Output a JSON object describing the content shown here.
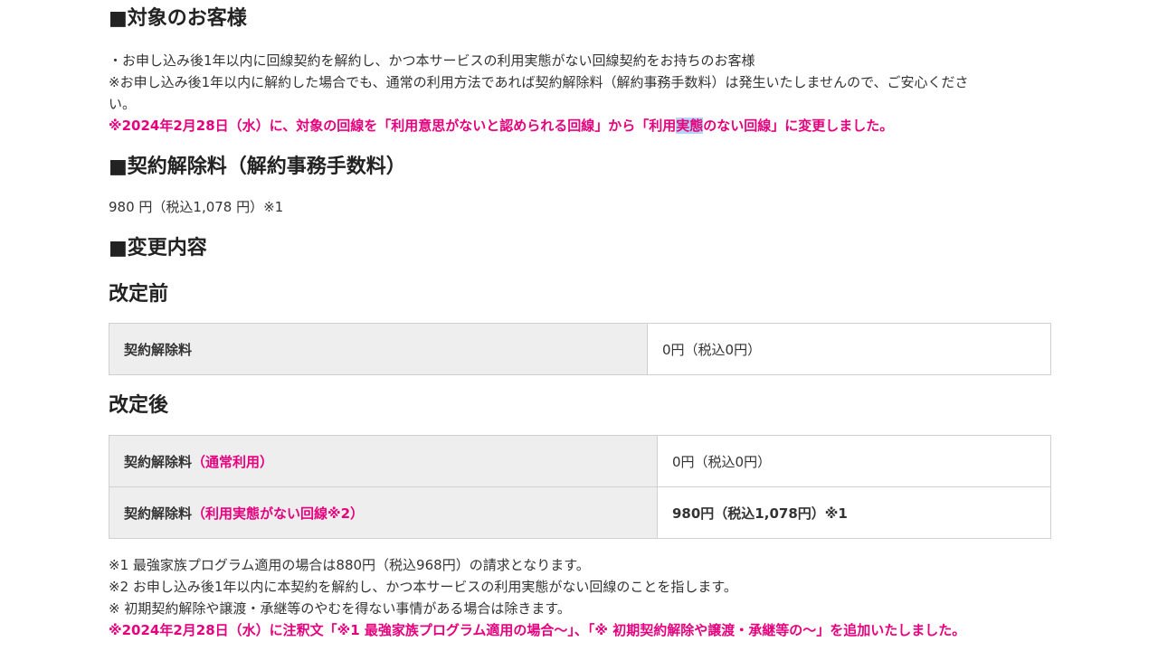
{
  "target": {
    "heading": "■対象のお客様",
    "line1": "・お申し込み後1年以内に回線契約を解約し、かつ本サービスの利用実態がない回線契約をお持ちのお客様",
    "line2": "※お申し込み後1年以内に解約した場合でも、通常の利用方法であれば契約解除料（解約事務手数料）は発生いたしませんので、ご安心くださ",
    "line2b": "い。",
    "notice_part1": "※2024年2月28日（水）に、対象の回線を「利用意思がないと認められる回線」から「利用",
    "notice_highlight": "実態",
    "notice_part2": "のない回線」に変更しました。"
  },
  "fee": {
    "heading": "■契約解除料（解約事務手数料）",
    "value": "980 円（税込1,078 円）※1"
  },
  "changes": {
    "heading": "■変更内容",
    "before": {
      "heading": "改定前",
      "rows": [
        {
          "label": "契約解除料",
          "note": "",
          "value": "0円（税込0円）"
        }
      ]
    },
    "after": {
      "heading": "改定後",
      "rows": [
        {
          "label": "契約解除料",
          "note": "（通常利用）",
          "value": "0円（税込0円）"
        },
        {
          "label": "契約解除料",
          "note": "（利用実態がない回線※2）",
          "value": "980円（税込1,078円）※1"
        }
      ]
    }
  },
  "footnotes": {
    "note1": "※1 最強家族プログラム適用の場合は880円（税込968円）の請求となります。",
    "note2": "※2 お申し込み後1年以内に本契約を解約し、かつ本サービスの利用実態がない回線のことを指します。",
    "note3": "※ 初期契約解除や譲渡・承継等のやむを得ない事情がある場合は除きます。",
    "notice": "※2024年2月28日（水）に注釈文「※1 最強家族プログラム適用の場合～」、「※ 初期契約解除や譲渡・承継等の～」を追加いたしました。"
  },
  "colors": {
    "accent_pink": "#e6007e",
    "table_header_bg": "#eeeeee",
    "table_border": "#d0d0d0",
    "selection_highlight": "#b4d5f5"
  }
}
